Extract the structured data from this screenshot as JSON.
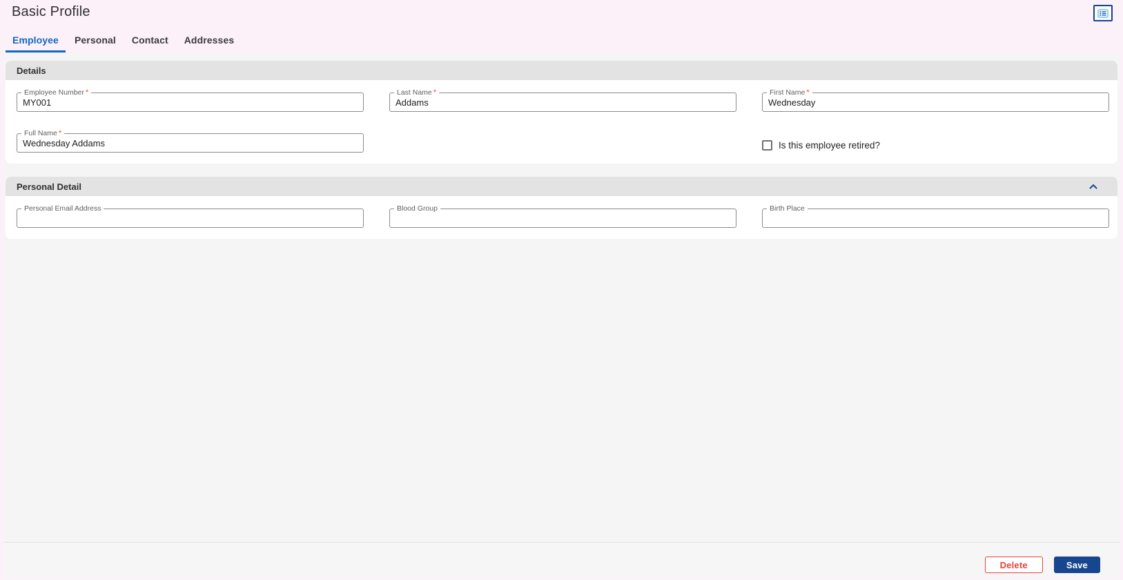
{
  "ui": {
    "required_marker": "*",
    "icons": {
      "header_toggle": "list-view-icon",
      "section_collapse": "chevron-up-icon"
    },
    "colors": {
      "page_bg": "#fcf1f9",
      "content_bg": "#f5f5f5",
      "section_header_bg": "#e3e3e3",
      "tab_active_blue": "#1565c0",
      "save_navy": "#17468f",
      "delete_red": "#e5433b",
      "required_red": "#f44336"
    }
  },
  "header": {
    "title": "Basic Profile"
  },
  "tabs": {
    "items": [
      {
        "label": "Employee",
        "active": true
      },
      {
        "label": "Personal",
        "active": false
      },
      {
        "label": "Contact",
        "active": false
      },
      {
        "label": "Addresses",
        "active": false
      }
    ]
  },
  "sections": {
    "details": {
      "title": "Details",
      "fields": {
        "employee_number": {
          "label": "Employee Number",
          "value": "MY001",
          "required": true
        },
        "last_name": {
          "label": "Last Name",
          "value": "Addams",
          "required": true
        },
        "first_name": {
          "label": "First Name",
          "value": "Wednesday",
          "required": true
        },
        "full_name": {
          "label": "Full Name",
          "value": "Wednesday Addams",
          "required": true
        }
      },
      "retired_checkbox": {
        "label": "Is this employee retired?",
        "checked": false
      }
    },
    "personal_detail": {
      "title": "Personal Detail",
      "collapsed": false,
      "fields": {
        "personal_email": {
          "label": "Personal Email Address",
          "value": "",
          "required": false
        },
        "blood_group": {
          "label": "Blood Group",
          "value": "",
          "required": false
        },
        "birth_place": {
          "label": "Birth Place",
          "value": "",
          "required": false
        }
      }
    }
  },
  "footer": {
    "delete_label": "Delete",
    "save_label": "Save"
  }
}
